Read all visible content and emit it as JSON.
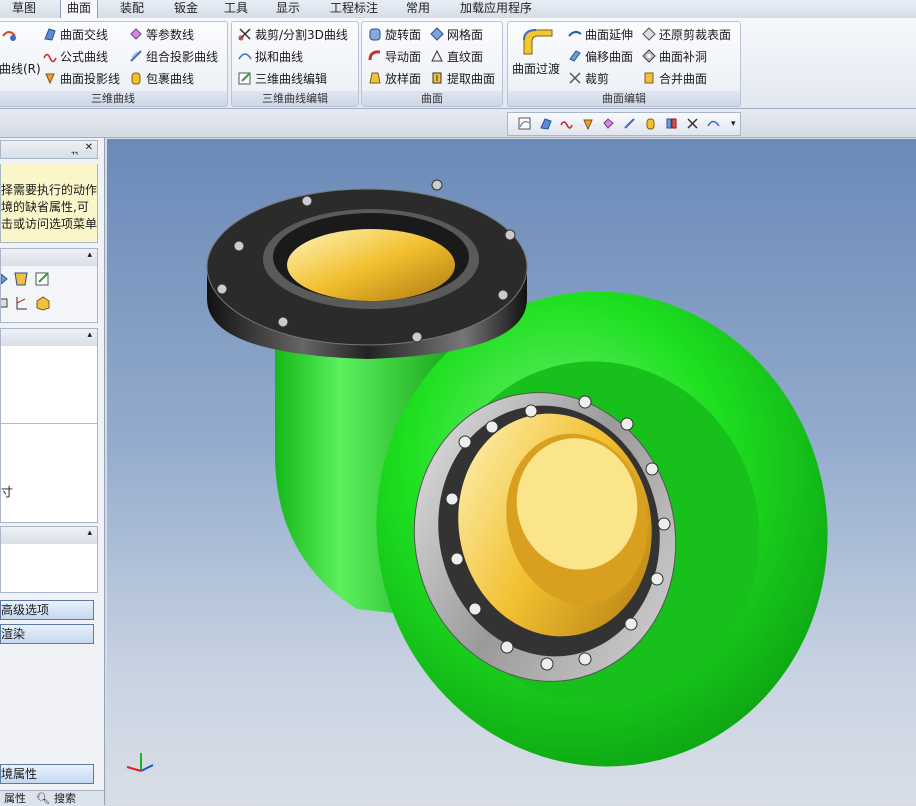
{
  "tabs": [
    "草图",
    "曲面",
    "装配",
    "钣金",
    "工具",
    "显示",
    "工程标注",
    "常用",
    "加载应用程序"
  ],
  "active_tab": "曲面",
  "groups": {
    "curves3d": {
      "title": "三维曲线",
      "first_button": "曲线(R)",
      "items": [
        "曲面交线",
        "公式曲线",
        "曲面投影线",
        "等参数线",
        "组合投影曲线",
        "包裹曲线"
      ]
    },
    "curve_edit": {
      "title": "三维曲线编辑",
      "items": [
        "裁剪/分割3D曲线",
        "拟和曲线",
        "三维曲线编辑"
      ]
    },
    "surface": {
      "title": "曲面",
      "items": [
        "旋转面",
        "导动面",
        "放样面",
        "网格面",
        "直纹面",
        "提取曲面"
      ]
    },
    "surface_edit": {
      "title": "曲面编辑",
      "big_button": "曲面过渡",
      "items": [
        "曲面延伸",
        "偏移曲面",
        "裁剪",
        "还原剪裁表面",
        "曲面补洞",
        "合并曲面"
      ]
    }
  },
  "panel": {
    "pin": "ᆩ",
    "close": "✕",
    "help_lines": [
      "择需要执行的动作",
      "境的缺省属性,可",
      "击或访问选项菜单"
    ],
    "size_label": "寸",
    "buttons": {
      "advanced": "高级选项",
      "render": "渲染",
      "env": "境属性"
    },
    "bottom_tabs": [
      "属性",
      "搜索"
    ]
  },
  "colors": {
    "accent": "#3f6fb0",
    "body": "#29e62c",
    "bore": "#f0b92a",
    "flange": "#2b2b2b"
  }
}
